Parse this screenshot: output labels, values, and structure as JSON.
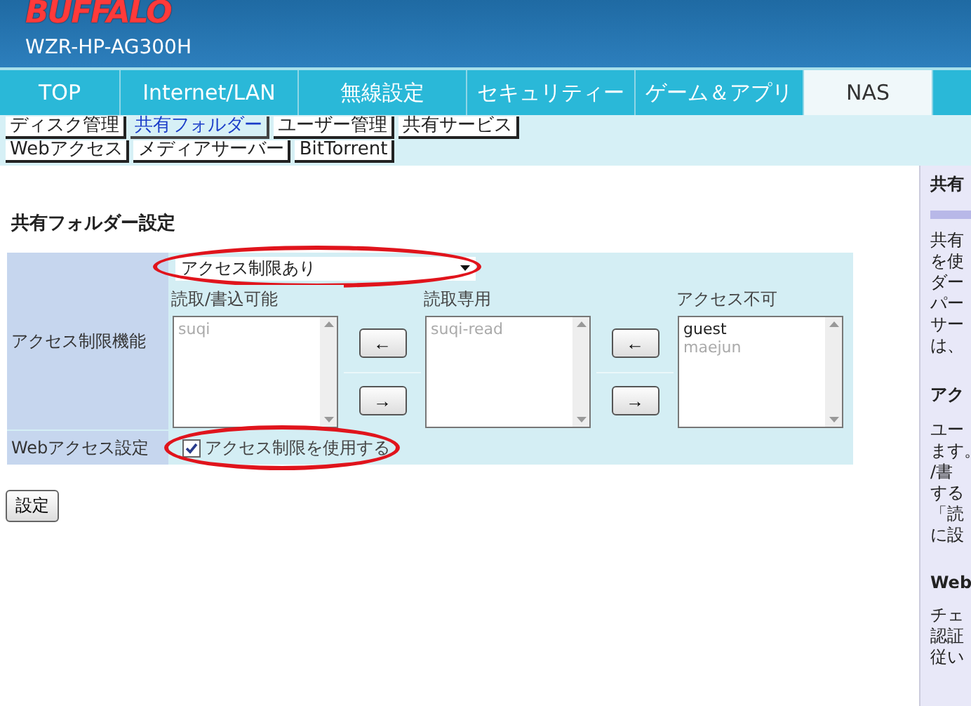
{
  "header": {
    "logo": "BUFFALO",
    "model": "WZR-HP-AG300H"
  },
  "tabs": [
    {
      "label": "TOP",
      "selected": false
    },
    {
      "label": "Internet/LAN",
      "selected": false
    },
    {
      "label": "無線設定",
      "selected": false
    },
    {
      "label": "セキュリティー",
      "selected": false
    },
    {
      "label": "ゲーム＆アプリ",
      "selected": false
    },
    {
      "label": "NAS",
      "selected": true
    }
  ],
  "subtabs": [
    [
      {
        "label": "ディスク管理",
        "selected": false
      },
      {
        "label": "共有フォルダー",
        "selected": true
      },
      {
        "label": "ユーザー管理",
        "selected": false
      },
      {
        "label": "共有サービス",
        "selected": false
      }
    ],
    [
      {
        "label": "Webアクセス",
        "selected": false
      },
      {
        "label": "メディアサーバー",
        "selected": false
      },
      {
        "label": "BitTorrent",
        "selected": false
      }
    ]
  ],
  "form": {
    "title": "共有フォルダー設定",
    "access_label": "アクセス制限機能",
    "mode_select": "アクセス制限あり",
    "lists": [
      {
        "heading": "読取/書込可能",
        "items": [
          "suqi"
        ]
      },
      {
        "heading": "読取専用",
        "items": [
          "suqi-read"
        ]
      },
      {
        "heading": "アクセス不可",
        "items": [
          "guest",
          "maejun"
        ]
      }
    ],
    "move_buttons": [
      {
        "left": "←",
        "right": "→"
      },
      {
        "left": "←",
        "right": "→"
      }
    ],
    "web_label": "Webアクセス設定",
    "web_checkbox": {
      "label": "アクセス制限を使用する",
      "checked": true
    },
    "submit": "設定"
  },
  "help": [
    {
      "heading": "共有",
      "lines": [
        "共有",
        "を使",
        "ダー",
        "パー",
        "サー",
        "は、"
      ]
    },
    {
      "heading": "アク",
      "lines": [
        "ユー",
        "ます。",
        "/書",
        "する",
        "「読",
        "に設"
      ]
    },
    {
      "heading": "Web",
      "lines": [
        "チェ",
        "認証",
        "従い"
      ]
    }
  ]
}
